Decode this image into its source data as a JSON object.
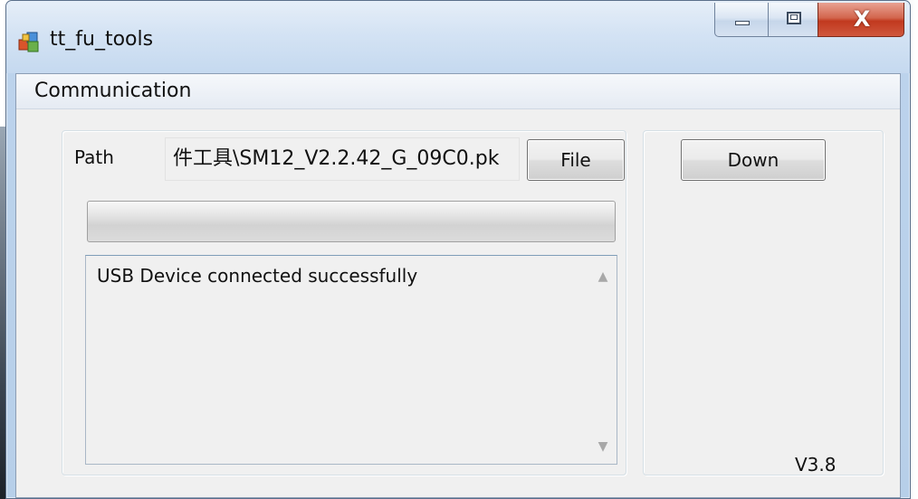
{
  "window": {
    "title": "tt_fu_tools",
    "icon": "app-cubes-icon"
  },
  "caption_buttons": {
    "minimize_icon": "minimize-icon",
    "maximize_icon": "maximize-icon",
    "close_glyph": "X"
  },
  "menu": {
    "items": [
      {
        "label": "Communication"
      }
    ]
  },
  "path": {
    "label": "Path",
    "value": "件工具\\SM12_V2.2.42_G_09C0.pk"
  },
  "buttons": {
    "file_label": "File",
    "down_label": "Down"
  },
  "progress": {
    "fraction": 0
  },
  "log": {
    "lines": [
      "USB Device connected successfully"
    ],
    "scroll_up_glyph": "▲",
    "scroll_down_glyph": "▼"
  },
  "version": "V3.8",
  "colors": {
    "titlebar_start": "#e6eef8",
    "titlebar_end": "#c5d9ef",
    "close_red": "#c1391f",
    "client_bg": "#f0f0f0"
  }
}
